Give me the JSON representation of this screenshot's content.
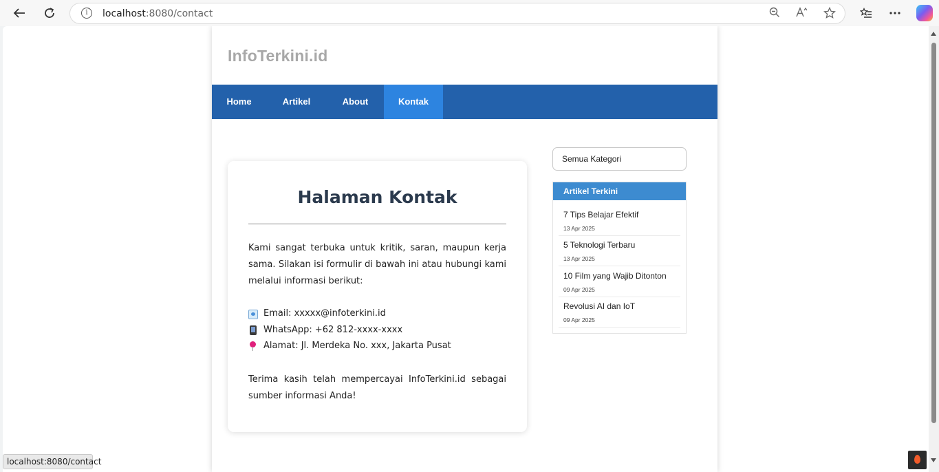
{
  "browser": {
    "url_host": "localhost",
    "url_path": ":8080/contact",
    "status_url": "localhost:8080/contact",
    "icons": [
      "back-arrow-icon",
      "refresh-icon",
      "site-info-icon",
      "zoom-out-icon",
      "read-aloud-icon",
      "favorite-star-icon",
      "favorites-list-icon",
      "more-menu-icon",
      "copilot-icon"
    ]
  },
  "site": {
    "logo": "InfoTerkini.id",
    "nav": [
      {
        "label": "Home"
      },
      {
        "label": "Artikel"
      },
      {
        "label": "About"
      },
      {
        "label": "Kontak",
        "active": true
      }
    ],
    "colors": {
      "nav_bg": "#2361ab",
      "nav_active": "#2d84e0",
      "sidebar_head": "#3d8bd0"
    }
  },
  "contact": {
    "title": "Halaman Kontak",
    "intro": "Kami sangat terbuka untuk kritik, saran, maupun kerja sama. Silakan isi formulir di bawah ini atau hubungi kami melalui informasi berikut:",
    "email": "Email: xxxxx@infoterkini.id",
    "whatsapp": "WhatsApp: +62 812-xxxx-xxxx",
    "address": "Alamat: Jl. Merdeka No. xxx, Jakarta Pusat",
    "closing": "Terima kasih telah mempercayai InfoTerkini.id sebagai sumber informasi Anda!"
  },
  "sidebar": {
    "category_select": "Semua Kategori",
    "latest_title": "Artikel Terkini",
    "articles": [
      {
        "title": "7 Tips Belajar Efektif",
        "date": "13 Apr 2025"
      },
      {
        "title": "5 Teknologi Terbaru",
        "date": "13 Apr 2025"
      },
      {
        "title": "10 Film yang Wajib Ditonton",
        "date": "09 Apr 2025"
      },
      {
        "title": "Revolusi AI dan IoT",
        "date": "09 Apr 2025"
      }
    ]
  }
}
